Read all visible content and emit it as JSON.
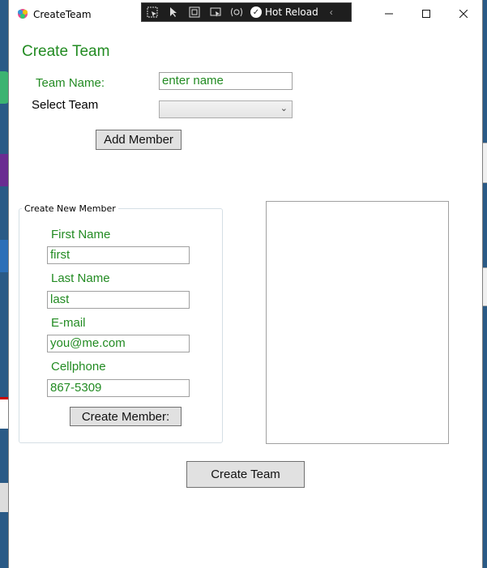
{
  "window": {
    "title": "CreateTeam"
  },
  "devtoolbar": {
    "hot_reload_label": "Hot Reload"
  },
  "form": {
    "heading": "Create Team",
    "team_name_label": "Team Name:",
    "team_name_value": "enter name",
    "select_team_label": "Select Team",
    "add_member_button": "Add Member"
  },
  "new_member": {
    "group_title": "Create New Member",
    "first_name_label": "First Name",
    "first_name_value": "first",
    "last_name_label": "Last Name",
    "last_name_value": "last",
    "email_label": "E-mail",
    "email_value": "you@me.com",
    "cellphone_label": "Cellphone",
    "cellphone_value": "867-5309",
    "create_member_button": "Create Member:"
  },
  "create_team_button": "Create Team",
  "colors": {
    "label_green": "#228b22",
    "desktop_blue": "#2a5a86"
  }
}
